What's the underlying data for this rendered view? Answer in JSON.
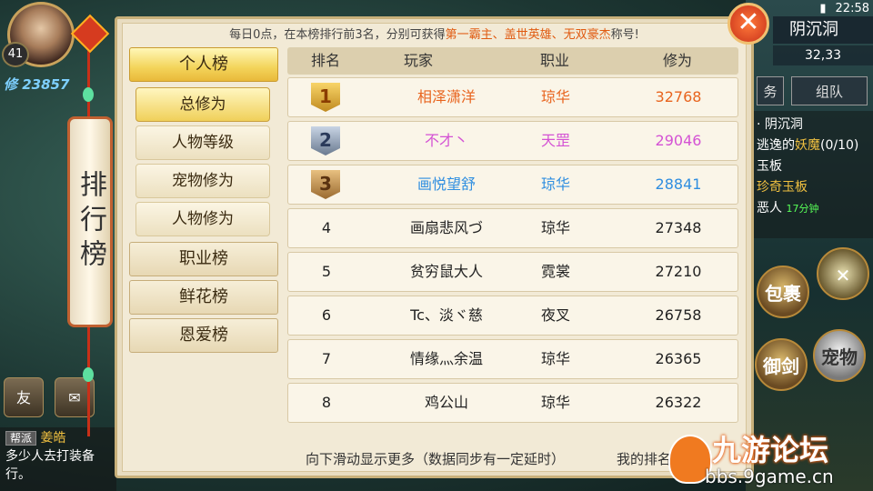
{
  "status_bar": {
    "time": "22:58"
  },
  "hero": {
    "level": "41",
    "cultivation": "修 23857"
  },
  "map": {
    "name": "阴沉洞",
    "coords": "32,33"
  },
  "side_buttons": {
    "task": "务",
    "team": "组队"
  },
  "quest": {
    "lines": [
      "· 阴沉洞",
      "逃逸的",
      "妖魔",
      "(0/10)",
      "玉板",
      "珍奇玉板",
      "恶人",
      "17分钟"
    ]
  },
  "right_icons": {
    "bag": "包裹",
    "sword": "御剑",
    "pet": "宠物"
  },
  "chat": {
    "tag": "帮派",
    "name": "姜皓",
    "text": "多少人去打装备行。"
  },
  "left_buttons": {
    "friend": "友"
  },
  "scroll_title": "排行榜",
  "panel": {
    "notice_prefix": "每日0点，在本榜排行前3名，分别可获得",
    "notice_highlight": "第一霸主、盖世英雄、无双豪杰",
    "notice_suffix": "称号!",
    "close_label": "✕",
    "menu": {
      "personal": "个人榜",
      "sub": [
        "总修为",
        "人物等级",
        "宠物修为",
        "人物修为"
      ],
      "job": "职业榜",
      "flower": "鲜花榜",
      "love": "恩爱榜"
    },
    "table": {
      "headers": [
        "排名",
        "玩家",
        "职业",
        "修为"
      ],
      "rows": [
        {
          "rank": "1",
          "player": "相泽潇洋",
          "job": "琼华",
          "score": "32768",
          "color": "#e8641e"
        },
        {
          "rank": "2",
          "player": "不才丶",
          "job": "天罡",
          "score": "29046",
          "color": "#d452d4"
        },
        {
          "rank": "3",
          "player": "画悦望舒",
          "job": "琼华",
          "score": "28841",
          "color": "#2f8ee0"
        },
        {
          "rank": "4",
          "player": "画扇悲风づ",
          "job": "琼华",
          "score": "27348",
          "color": "#222222"
        },
        {
          "rank": "5",
          "player": "贫穷鼠大人",
          "job": "霓裳",
          "score": "27210",
          "color": "#222222"
        },
        {
          "rank": "6",
          "player": "Tc、淡ヾ慈",
          "job": "夜叉",
          "score": "26758",
          "color": "#222222"
        },
        {
          "rank": "7",
          "player": "情缘灬余温",
          "job": "琼华",
          "score": "26365",
          "color": "#222222"
        },
        {
          "rank": "8",
          "player": "鸡公山",
          "job": "琼华",
          "score": "26322",
          "color": "#222222"
        }
      ]
    },
    "footer_hint": "向下滑动显示更多（数据同步有一定延时）",
    "my_rank_label": "我的排名"
  },
  "watermark": {
    "title": "九游论坛",
    "url": "bbs.9game.cn"
  }
}
